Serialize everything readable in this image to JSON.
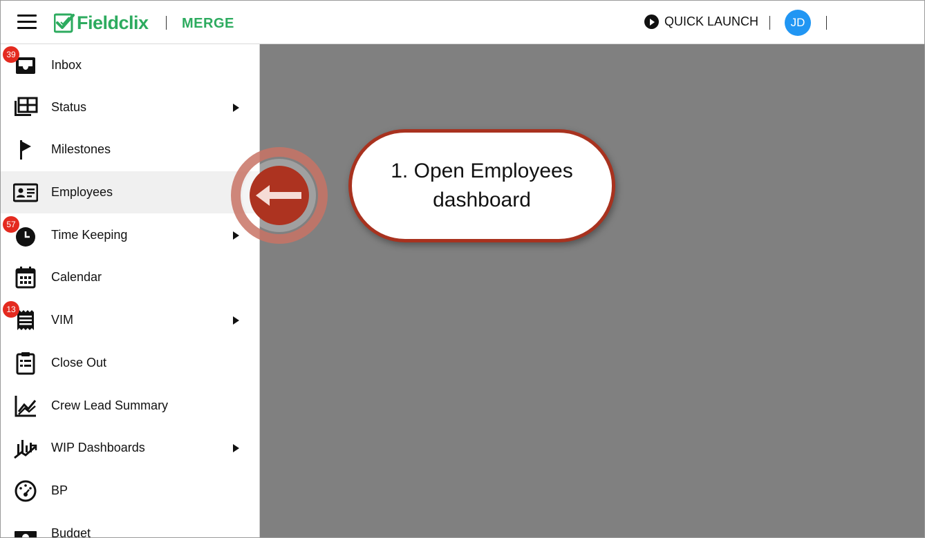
{
  "header": {
    "logo_text": "Fieldclix",
    "module": "MERGE",
    "quick_launch_label": "QUICK LAUNCH",
    "user_initials": "JD",
    "brand_color": "#2dab5f",
    "avatar_color": "#2196f3"
  },
  "sidebar": {
    "items": [
      {
        "label": "Inbox",
        "icon": "inbox-icon",
        "badge": "39",
        "has_submenu": false,
        "active": false
      },
      {
        "label": "Status",
        "icon": "table-grid-icon",
        "badge": "",
        "has_submenu": true,
        "active": false
      },
      {
        "label": "Milestones",
        "icon": "flag-icon",
        "badge": "",
        "has_submenu": false,
        "active": false
      },
      {
        "label": "Employees",
        "icon": "id-card-icon",
        "badge": "",
        "has_submenu": false,
        "active": true
      },
      {
        "label": "Time Keeping",
        "icon": "clock-icon",
        "badge": "57",
        "has_submenu": true,
        "active": false
      },
      {
        "label": "Calendar",
        "icon": "calendar-icon",
        "badge": "",
        "has_submenu": false,
        "active": false
      },
      {
        "label": "VIM",
        "icon": "receipt-icon",
        "badge": "13",
        "has_submenu": true,
        "active": false
      },
      {
        "label": "Close Out",
        "icon": "clipboard-list-icon",
        "badge": "",
        "has_submenu": false,
        "active": false
      },
      {
        "label": "Crew Lead Summary",
        "icon": "line-chart-icon",
        "badge": "",
        "has_submenu": false,
        "active": false
      },
      {
        "label": "WIP Dashboards",
        "icon": "chart-trend-icon",
        "badge": "",
        "has_submenu": true,
        "active": false
      },
      {
        "label": "BP",
        "icon": "gauge-icon",
        "badge": "",
        "has_submenu": false,
        "active": false
      },
      {
        "label": "Budget",
        "icon": "money-icon",
        "badge": "",
        "has_submenu": false,
        "active": false
      }
    ]
  },
  "callout": {
    "text_line1": "1. Open Employees",
    "text_line2": "dashboard",
    "accent_color": "#a8321f"
  },
  "badge_color": "#e42a1f",
  "overlay_color": "#808080"
}
